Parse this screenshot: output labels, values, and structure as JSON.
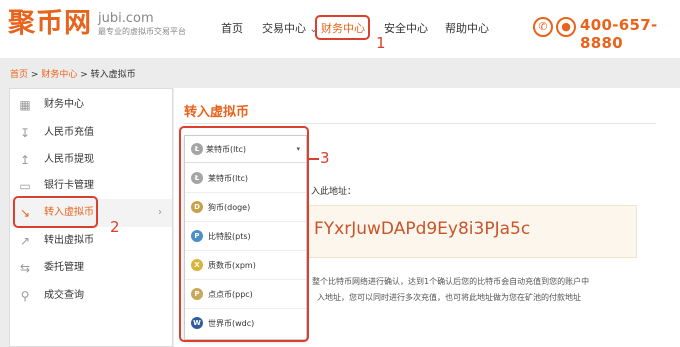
{
  "brand": {
    "name_cn": "聚币网",
    "domain": "jubi.com",
    "slogan": "最专业的虚拟币交易平台",
    "accent": "#e8641d"
  },
  "nav": {
    "home": "首页",
    "trade": "交易中心",
    "trade_caret": "⌄",
    "finance": "财务中心",
    "security": "安全中心",
    "help": "帮助中心",
    "phone_icon": "phone-icon",
    "support_icon": "support-icon",
    "phone": "400-657-8880"
  },
  "breadcrumb": {
    "home": "首页",
    "sep": ">",
    "finance": "财务中心",
    "current": "转入虚拟币"
  },
  "sidebar": {
    "items": [
      {
        "label": "财务中心",
        "icon": "finance-icon"
      },
      {
        "label": "人民币充值",
        "icon": "download-icon"
      },
      {
        "label": "人民币提现",
        "icon": "upload-icon"
      },
      {
        "label": "银行卡管理",
        "icon": "card-icon"
      },
      {
        "label": "转入虚拟币",
        "icon": "import-icon"
      },
      {
        "label": "转出虚拟币",
        "icon": "export-icon"
      },
      {
        "label": "委托管理",
        "icon": "swap-icon"
      },
      {
        "label": "成交查询",
        "icon": "search-icon"
      }
    ],
    "active_chevron": "›"
  },
  "main": {
    "title": "转入虚拟币",
    "address_label": "入此地址：",
    "address": "FYxrJuwDAPd9Ey8i3PJa5c",
    "note_line1": "整个比特币网络进行确认，达到1个确认后您的比特币会自动充值到您的账户中",
    "note_line2": "入地址，您可以同时进行多次充值，也可将此地址做为您在矿池的付款地址"
  },
  "dropdown": {
    "selected": "莱特币(ltc)",
    "caret": "▾",
    "options": [
      {
        "label": "莱特币(ltc)",
        "icon": "ltc-coin-icon",
        "color": "#a5a5a5",
        "glyph": "Ł"
      },
      {
        "label": "狗币(doge)",
        "icon": "doge-coin-icon",
        "color": "#c8a24a",
        "glyph": "D"
      },
      {
        "label": "比特股(pts)",
        "icon": "pts-coin-icon",
        "color": "#4a90c8",
        "glyph": "P"
      },
      {
        "label": "质数币(xpm)",
        "icon": "xpm-coin-icon",
        "color": "#d9b43a",
        "glyph": "X"
      },
      {
        "label": "点点币(ppc)",
        "icon": "ppc-coin-icon",
        "color": "#c9a75a",
        "glyph": "P"
      },
      {
        "label": "世界币(wdc)",
        "icon": "wdc-coin-icon",
        "color": "#2f5d9a",
        "glyph": "W"
      }
    ]
  },
  "annotations": {
    "step1": "1",
    "step2": "2",
    "step3": "3",
    "color": "#d9412e"
  }
}
